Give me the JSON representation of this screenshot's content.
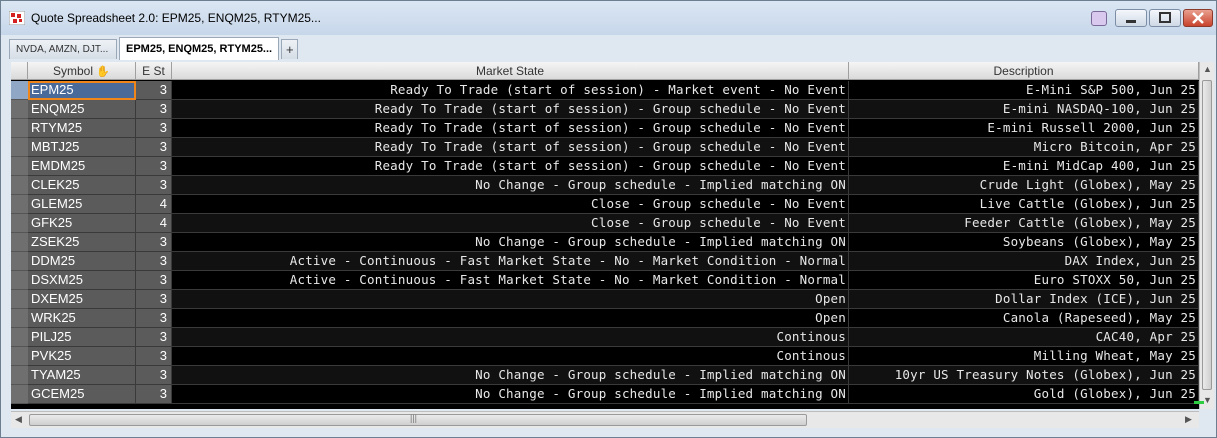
{
  "window": {
    "title": "Quote Spreadsheet 2.0: EPM25, ENQM25, RTYM25...",
    "colors": {
      "accent": "#f0851a",
      "close": "#c8422c"
    }
  },
  "tabs": [
    {
      "label": "NVDA, AMZN, DJT...",
      "active": false
    },
    {
      "label": "EPM25, ENQM25, RTYM25...",
      "active": true
    },
    {
      "label": "+",
      "active": false
    }
  ],
  "grid": {
    "headers": {
      "symbol": "Symbol",
      "est": "E St",
      "market_state": "Market State",
      "description": "Description"
    },
    "rows": [
      {
        "symbol": "EPM25",
        "est": "3",
        "market_state": "Ready To Trade (start of session) - Market event - No Event",
        "description": "E-Mini S&P 500, Jun 25"
      },
      {
        "symbol": "ENQM25",
        "est": "3",
        "market_state": "Ready To Trade (start of session) - Group schedule - No Event",
        "description": "E-mini NASDAQ-100, Jun 25"
      },
      {
        "symbol": "RTYM25",
        "est": "3",
        "market_state": "Ready To Trade (start of session) - Group schedule - No Event",
        "description": "E-mini Russell 2000, Jun 25"
      },
      {
        "symbol": "MBTJ25",
        "est": "3",
        "market_state": "Ready To Trade (start of session) - Group schedule - No Event",
        "description": "Micro Bitcoin, Apr 25"
      },
      {
        "symbol": "EMDM25",
        "est": "3",
        "market_state": "Ready To Trade (start of session) - Group schedule - No Event",
        "description": "E-mini MidCap 400, Jun 25"
      },
      {
        "symbol": "CLEK25",
        "est": "3",
        "market_state": "No Change - Group schedule - Implied matching ON",
        "description": "Crude Light (Globex), May 25"
      },
      {
        "symbol": "GLEM25",
        "est": "4",
        "market_state": "Close - Group schedule - No Event",
        "description": "Live Cattle (Globex), Jun 25"
      },
      {
        "symbol": "GFK25",
        "est": "4",
        "market_state": "Close - Group schedule - No Event",
        "description": "Feeder Cattle (Globex), May 25"
      },
      {
        "symbol": "ZSEK25",
        "est": "3",
        "market_state": "No Change - Group schedule - Implied matching ON",
        "description": "Soybeans (Globex), May 25"
      },
      {
        "symbol": "DDM25",
        "est": "3",
        "market_state": "Active - Continuous - Fast Market State - No - Market Condition - Normal",
        "description": "DAX Index, Jun 25"
      },
      {
        "symbol": "DSXM25",
        "est": "3",
        "market_state": "Active - Continuous - Fast Market State - No - Market Condition - Normal",
        "description": "Euro STOXX 50, Jun 25"
      },
      {
        "symbol": "DXEM25",
        "est": "3",
        "market_state": "Open",
        "description": "Dollar Index (ICE), Jun 25"
      },
      {
        "symbol": "WRK25",
        "est": "3",
        "market_state": "Open",
        "description": "Canola (Rapeseed), May 25"
      },
      {
        "symbol": "PILJ25",
        "est": "3",
        "market_state": "Continous",
        "description": "CAC40, Apr 25"
      },
      {
        "symbol": "PVK25",
        "est": "3",
        "market_state": "Continous",
        "description": "Milling Wheat, May 25"
      },
      {
        "symbol": "TYAM25",
        "est": "3",
        "market_state": "No Change - Group schedule - Implied matching ON",
        "description": "10yr US Treasury Notes (Globex), Jun 25"
      },
      {
        "symbol": "GCEM25",
        "est": "3",
        "market_state": "No Change - Group schedule - Implied matching ON",
        "description": "Gold (Globex), Jun 25"
      }
    ],
    "selected_row": 0
  },
  "icons": {
    "app": "app-icon",
    "sort": "hand-pointer-icon",
    "scroll_grip": "grip-icon"
  },
  "scroll": {
    "hgrip": "|||"
  }
}
